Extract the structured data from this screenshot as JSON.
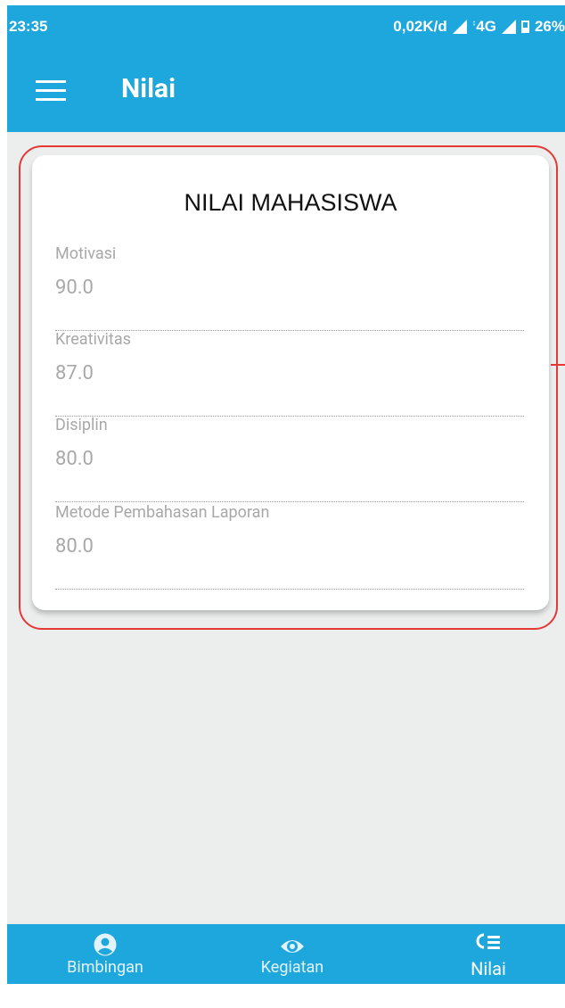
{
  "status_bar": {
    "time": "23:35",
    "net_speed": "0,02K/d",
    "network": "4G",
    "battery": "26%"
  },
  "app_bar": {
    "title": "Nilai"
  },
  "card": {
    "title": "NILAI MAHASISWA",
    "fields": [
      {
        "label": "Motivasi",
        "value": "90.0"
      },
      {
        "label": "Kreativitas",
        "value": "87.0"
      },
      {
        "label": "Disiplin",
        "value": "80.0"
      },
      {
        "label": "Metode Pembahasan Laporan",
        "value": "80.0"
      }
    ]
  },
  "bottom_nav": [
    {
      "label": "Bimbingan",
      "icon": "account-circle-icon"
    },
    {
      "label": "Kegiatan",
      "icon": "eye-icon"
    },
    {
      "label": "Nilai",
      "icon": "grades-list-icon",
      "active": true
    }
  ],
  "colors": {
    "primary": "#1ea7dc",
    "background": "#eceeed",
    "highlight": "#e53935"
  }
}
